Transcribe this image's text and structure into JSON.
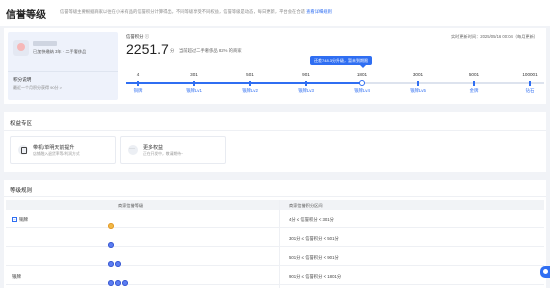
{
  "header": {
    "title": "信誉等级",
    "desc": "信誉等级主要根据商家以往在小米有品的信誉积分计算得出，不同等级享受不同权益，信誉等级是动态，每日更新，平台会在合适",
    "link": "查看详细规则"
  },
  "profile": {
    "badge": "已加快缴纳 3年 · 二手奢侈品",
    "score_label": "积分说明",
    "score_sub": "最近一个月积分获得 90分 >"
  },
  "credit": {
    "label": "信誉积分 ⓘ",
    "value": "2251.7",
    "unit": "分",
    "desc": "当前超过二手奢侈品 82% 的商家",
    "update_time": "实时更新时间：2025/05/16 00:04（每月更新）",
    "tooltip": "还差748.3分升级，暂未到期限",
    "progress": 0.57,
    "levels": [
      {
        "score": "4",
        "name": "铜牌",
        "current": false
      },
      {
        "score": "301",
        "name": "银牌Lv1",
        "current": false
      },
      {
        "score": "501",
        "name": "银牌Lv2",
        "current": false
      },
      {
        "score": "901",
        "name": "银牌Lv3",
        "current": false
      },
      {
        "score": "1801",
        "name": "银牌Lv4",
        "current": true
      },
      {
        "score": "3001",
        "name": "银牌Lv5",
        "current": false
      },
      {
        "score": "5001",
        "name": "金牌",
        "current": false
      },
      {
        "score": "100001",
        "name": "钻石",
        "current": false
      }
    ]
  },
  "rights": {
    "title": "权益专区",
    "items": [
      {
        "name": "带机/单明天前提升",
        "desc": "店铺融入退货率等/利润方式",
        "icon": "document-icon"
      },
      {
        "name": "更多权益",
        "desc": "正在开发中，敬请期待~",
        "icon": "more-icon"
      }
    ]
  },
  "rules": {
    "title": "等级规则",
    "col1": "商家信誉等级",
    "col2": "商家信誉积分区间",
    "rows": [
      {
        "level": "铜牌",
        "collapsible": true,
        "medals": [
          "gold"
        ],
        "range": "4分 ≤ 信誉积分 < 301分"
      },
      {
        "level": "",
        "collapsible": false,
        "medals": [
          "blue"
        ],
        "range": "301分 ≤ 信誉积分 < 501分"
      },
      {
        "level": "",
        "collapsible": false,
        "medals": [
          "blue",
          "blue"
        ],
        "range": "501分 ≤ 信誉积分 < 901分"
      },
      {
        "level": "银牌",
        "collapsible": false,
        "medals": [
          "blue",
          "blue",
          "blue"
        ],
        "range": "901分 ≤ 信誉积分 < 1801分"
      }
    ]
  }
}
